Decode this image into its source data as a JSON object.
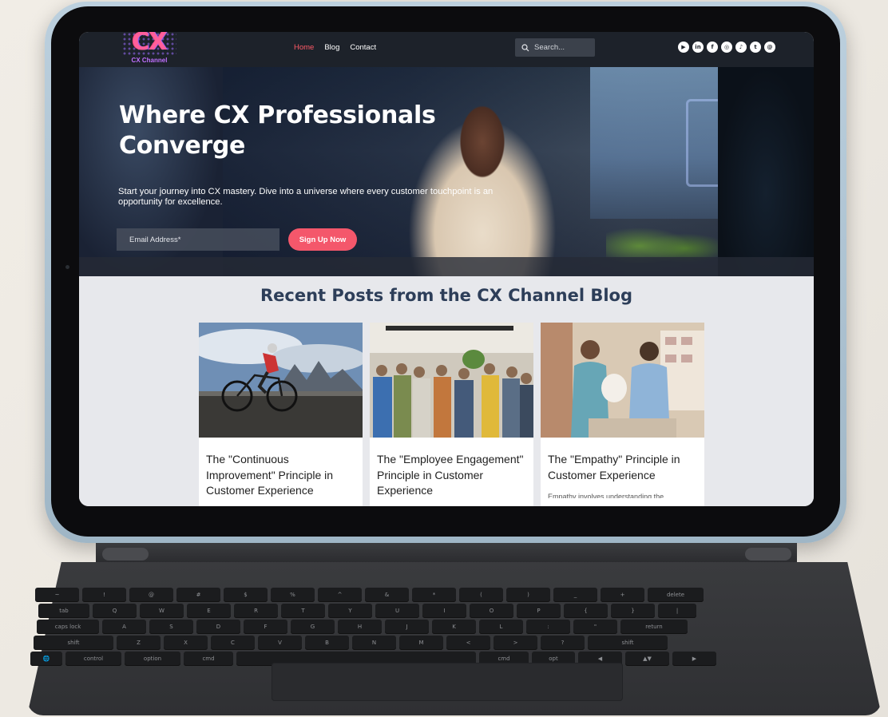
{
  "brand": {
    "logo_mark": "CX",
    "logo_text": "CX Channel",
    "accent": "#f4576b"
  },
  "nav": {
    "links": [
      {
        "label": "Home",
        "active": true
      },
      {
        "label": "Blog",
        "active": false
      },
      {
        "label": "Contact",
        "active": false
      }
    ],
    "search_placeholder": "Search..."
  },
  "social": [
    {
      "icon": "youtube-icon",
      "glyph": "▶"
    },
    {
      "icon": "linkedin-icon",
      "glyph": "in"
    },
    {
      "icon": "facebook-icon",
      "glyph": "f"
    },
    {
      "icon": "instagram-icon",
      "glyph": "◎"
    },
    {
      "icon": "tiktok-icon",
      "glyph": "♪"
    },
    {
      "icon": "twitter-icon",
      "glyph": "t"
    },
    {
      "icon": "threads-icon",
      "glyph": "@"
    }
  ],
  "hero": {
    "title": "Where CX Professionals Converge",
    "subtitle": "Start your journey into CX mastery. Dive into a universe where every customer touchpoint is an opportunity for excellence.",
    "email_placeholder": "Email Address*",
    "signup_label": "Sign Up Now"
  },
  "posts": {
    "heading": "Recent Posts from the CX Channel Blog",
    "items": [
      {
        "title": "The \"Continuous Improvement\" Principle in Customer Experience",
        "excerpt": ""
      },
      {
        "title": "The \"Employee Engagement\" Principle in Customer Experience",
        "excerpt": ""
      },
      {
        "title": "The \"Empathy\" Principle in Customer Experience",
        "excerpt": "Empathy involves understanding the"
      }
    ]
  },
  "keyboard": {
    "rows": [
      [
        "~",
        "!",
        "@",
        "#",
        "$",
        "%",
        "^",
        "&",
        "*",
        "(",
        ")",
        "_",
        "+",
        "delete"
      ],
      [
        "tab",
        "Q",
        "W",
        "E",
        "R",
        "T",
        "Y",
        "U",
        "I",
        "O",
        "P",
        "{",
        "}",
        "|"
      ],
      [
        "caps lock",
        "A",
        "S",
        "D",
        "F",
        "G",
        "H",
        "J",
        "K",
        "L",
        ":",
        "\"",
        "return"
      ],
      [
        "shift",
        "Z",
        "X",
        "C",
        "V",
        "B",
        "N",
        "M",
        "<",
        ">",
        "?",
        "shift"
      ],
      [
        "🌐",
        "control",
        "option",
        "cmd",
        "",
        "cmd",
        "opt",
        "◀",
        "▲▼",
        "▶"
      ]
    ]
  }
}
